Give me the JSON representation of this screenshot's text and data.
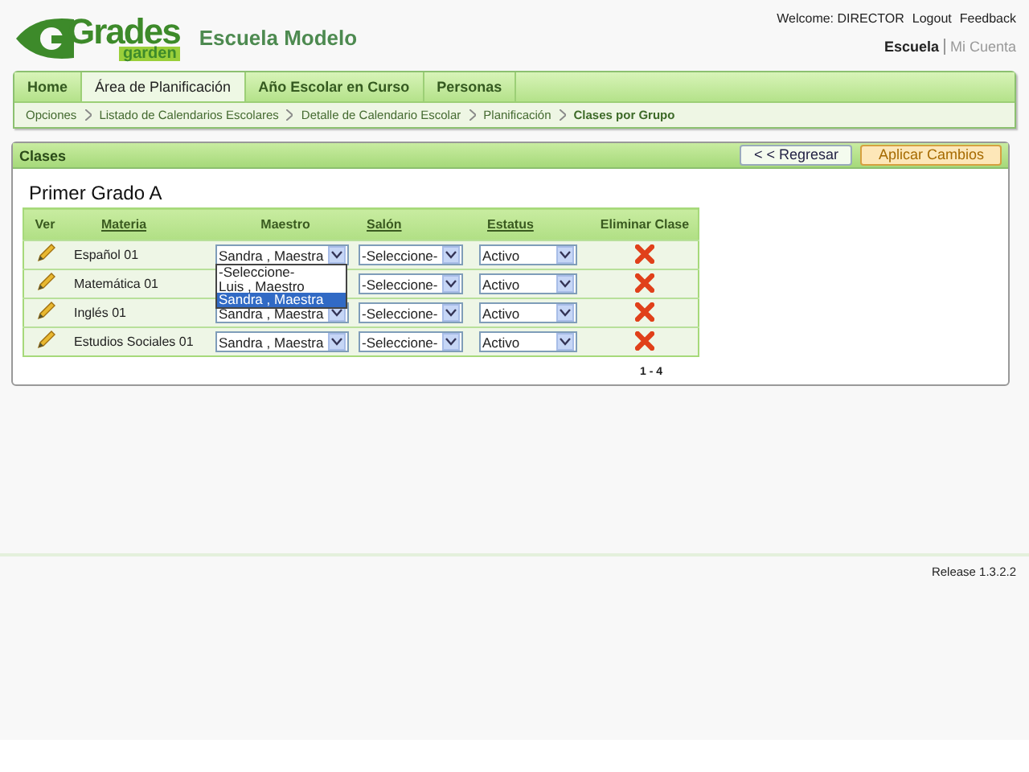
{
  "header": {
    "logo": {
      "title": "Grades",
      "subtitle": "garden"
    },
    "school": "Escuela Modelo",
    "welcome": "Welcome: DIRECTOR",
    "links": [
      "Logout",
      "Feedback"
    ],
    "context": [
      {
        "label": "Escuela",
        "selected": true
      },
      {
        "label": "Mi Cuenta",
        "selected": false
      }
    ]
  },
  "tabs": [
    {
      "label": "Home",
      "selected": false
    },
    {
      "label": "Área de Planificación",
      "selected": true
    },
    {
      "label": "Año Escolar en Curso",
      "selected": false
    },
    {
      "label": "Personas",
      "selected": false
    }
  ],
  "breadcrumb": [
    {
      "label": "Opciones",
      "current": false
    },
    {
      "label": "Listado de Calendarios Escolares",
      "current": false
    },
    {
      "label": "Detalle de Calendario Escolar",
      "current": false
    },
    {
      "label": "Planificación",
      "current": false
    },
    {
      "label": "Clases por Grupo",
      "current": true
    }
  ],
  "panel": {
    "title": "Clases",
    "buttons": [
      {
        "label": "< < Regresar",
        "kind": "back"
      },
      {
        "label": "Aplicar Cambios",
        "kind": "primary"
      }
    ],
    "group": "Primer Grado A",
    "table": {
      "columns": [
        {
          "label": "Ver",
          "link": false
        },
        {
          "label": "Materia",
          "link": true
        },
        {
          "label": "Maestro",
          "link": false
        },
        {
          "label": "Salón",
          "link": true
        },
        {
          "label": "Estatus",
          "link": true
        },
        {
          "label": "Eliminar Clase",
          "link": false
        }
      ],
      "rows": [
        {
          "materia": "Español 01",
          "maestro": {
            "value": "Sandra , Maestra",
            "open": true,
            "options": [
              {
                "label": "-Seleccione-",
                "selected": false
              },
              {
                "label": "Luis , Maestro",
                "selected": false
              },
              {
                "label": "Sandra , Maestra",
                "selected": true
              }
            ]
          },
          "salon": "-Seleccione-",
          "estatus": "Activo"
        },
        {
          "materia": "Matemática 01",
          "salon": "-Seleccione-",
          "estatus": "Activo"
        },
        {
          "materia": "Inglés 01",
          "maestro": {
            "value": "Sandra , Maestra",
            "open": false
          },
          "salon": "-Seleccione-",
          "estatus": "Activo"
        },
        {
          "materia": "Estudios Sociales 01",
          "maestro": {
            "value": "Sandra , Maestra",
            "open": false
          },
          "salon": "-Seleccione-",
          "estatus": "Activo"
        }
      ]
    },
    "pager": "1 - 4"
  },
  "footer": {
    "release": "Release 1.3.2.2"
  }
}
